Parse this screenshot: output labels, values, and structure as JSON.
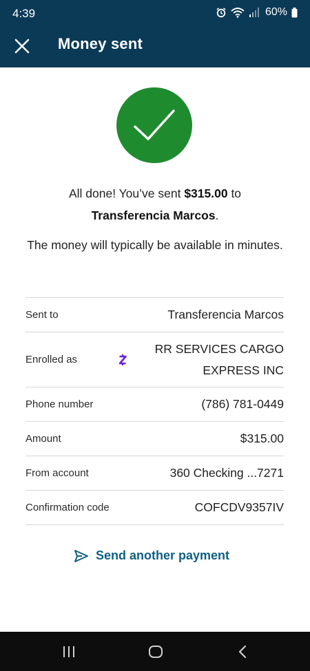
{
  "status_bar": {
    "time": "4:39",
    "battery": "60%"
  },
  "app_bar": {
    "title": "Money sent"
  },
  "message": {
    "line1_prefix": "All done! You’ve sent ",
    "amount": "$315.00",
    "line1_suffix": " to",
    "recipient": "Transferencia Marcos",
    "period": ".",
    "availability": "The money will typically be available in minutes."
  },
  "details": {
    "sent_to": {
      "label": "Sent to",
      "value": "Transferencia Marcos"
    },
    "enrolled_as": {
      "label": "Enrolled as",
      "value_line1": "RR SERVICES CARGO",
      "value_line2": "EXPRESS INC"
    },
    "phone": {
      "label": "Phone number",
      "value": "(786) 781-0449"
    },
    "amount": {
      "label": "Amount",
      "value": "$315.00"
    },
    "from_account": {
      "label": "From account",
      "value": "360 Checking ...7271"
    },
    "confirmation": {
      "label": "Confirmation code",
      "value": "COFCDV9357IV"
    }
  },
  "actions": {
    "send_another": "Send another payment"
  },
  "colors": {
    "header_bg": "#0b3a57",
    "success_green": "#1f8b2f",
    "link_blue": "#0f5f86",
    "zelle_purple": "#6d1ed4"
  },
  "icons": {
    "close": "close-icon",
    "check": "check-icon",
    "zelle": "zelle-icon",
    "send": "send-icon"
  }
}
